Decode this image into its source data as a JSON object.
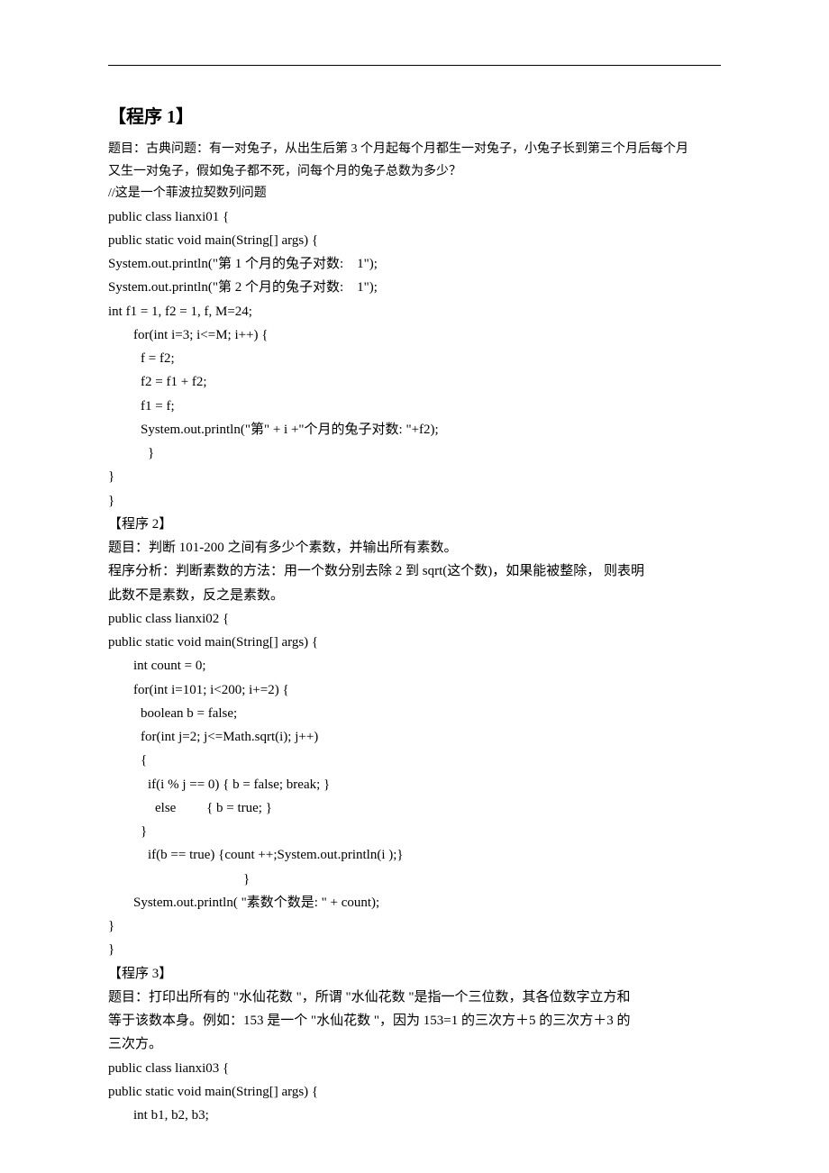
{
  "hr": "",
  "p1": {
    "title": "【程序 1】",
    "desc1": "题目：古典问题：有一对兔子，从出生后第 3 个月起每个月都生一对兔子，小兔子长到第三个月后每个月",
    "desc2": "又生一对兔子，假如兔子都不死，问每个月的兔子总数为多少？",
    "comment": "//这是一个菲波拉契数列问题",
    "l1": "public class lianxi01 {",
    "l2": "public static void main(String[] args) {",
    "l3": "System.out.println(\"第 1 个月的兔子对数:    1\");",
    "l4": "System.out.println(\"第 2 个月的兔子对数:    1\");",
    "l5": "int f1 = 1, f2 = 1, f, M=24;",
    "l6": "for(int i=3; i<=M; i++) {",
    "l7": "f = f2;",
    "l8": "f2 = f1 + f2;",
    "l9": "f1 = f;",
    "l10": "System.out.println(\"第\" + i +\"个月的兔子对数: \"+f2);",
    "l11": "}",
    "l12": "}",
    "l13": "}"
  },
  "p2": {
    "title": "【程序 2】",
    "desc1": "题目：判断 101-200 之间有多少个素数，并输出所有素数。",
    "desc2": "程序分析：判断素数的方法：用一个数分别去除 2 到 sqrt(这个数)，如果能被整除，   则表明",
    "desc3": "此数不是素数，反之是素数。",
    "l1": "public class lianxi02 {",
    "l2": "public static void main(String[] args) {",
    "l3": "int count = 0;",
    "l4": "for(int i=101; i<200; i+=2) {",
    "l5": "boolean b = false;",
    "l6": "for(int j=2; j<=Math.sqrt(i); j++)",
    "l7": "{",
    "l8": "if(i % j == 0) { b = false; break; }",
    "l9": "else         { b = true; }",
    "l10": "}",
    "l11": "if(b == true) {count ++;System.out.println(i );}",
    "l12": "}",
    "l13": "System.out.println( \"素数个数是: \" + count);",
    "l14": "}",
    "l15": "}"
  },
  "p3": {
    "title": "【程序 3】",
    "desc1": "题目：打印出所有的 \"水仙花数 \"，所谓 \"水仙花数 \"是指一个三位数，其各位数字立方和",
    "desc2": "等于该数本身。例如：153 是一个 \"水仙花数 \"，因为 153=1 的三次方＋5 的三次方＋3 的",
    "desc3": "三次方。",
    "l1": "public class lianxi03 {",
    "l2": "public static void main(String[] args) {",
    "l3": "int b1, b2, b3;"
  }
}
